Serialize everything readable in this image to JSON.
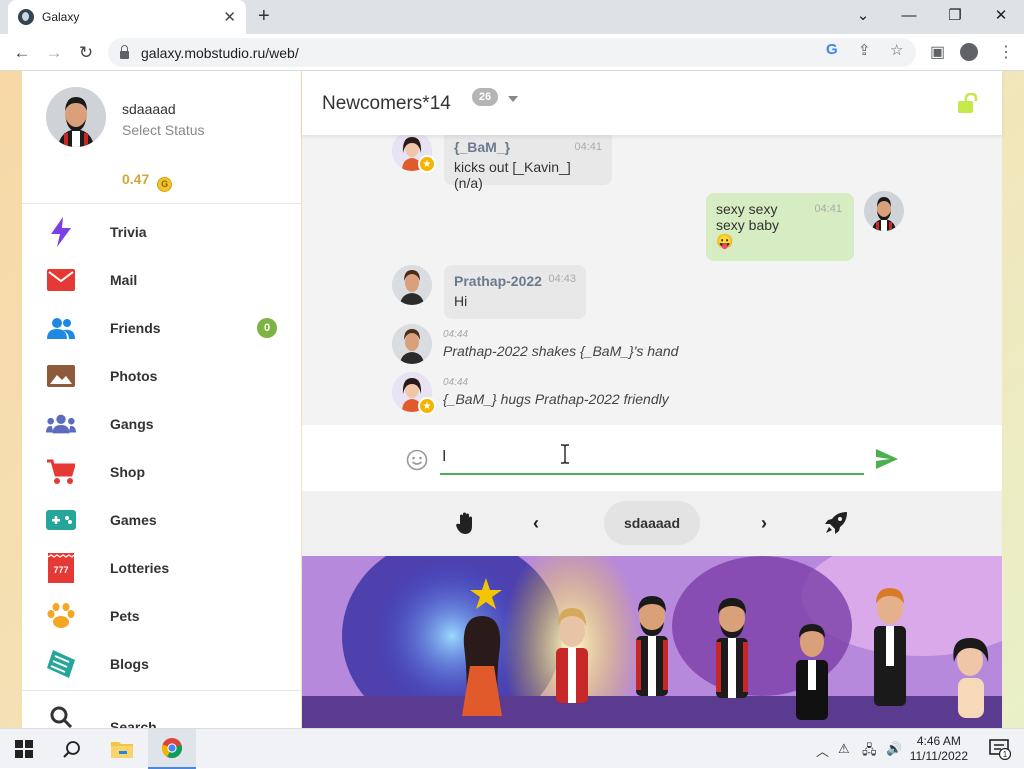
{
  "browser": {
    "tab_title": "Galaxy",
    "url": "galaxy.mobstudio.ru/web/"
  },
  "sidebar": {
    "username": "sdaaaad",
    "status": "Select Status",
    "coins": "0.47",
    "items": [
      {
        "label": "Trivia",
        "icon": "lightning-icon",
        "color": "#7b3fe4"
      },
      {
        "label": "Mail",
        "icon": "mail-icon",
        "color": "#e53935"
      },
      {
        "label": "Friends",
        "icon": "friends-icon",
        "color": "#1e88e5",
        "badge": "0"
      },
      {
        "label": "Photos",
        "icon": "photo-icon",
        "color": "#8d5a3b"
      },
      {
        "label": "Gangs",
        "icon": "group-icon",
        "color": "#5c6bc0"
      },
      {
        "label": "Shop",
        "icon": "cart-icon",
        "color": "#e53935"
      },
      {
        "label": "Games",
        "icon": "gamepad-icon",
        "color": "#26a69a"
      },
      {
        "label": "Lotteries",
        "icon": "ticket-icon",
        "color": "#e53935"
      },
      {
        "label": "Pets",
        "icon": "paw-icon",
        "color": "#f5a623"
      },
      {
        "label": "Blogs",
        "icon": "blog-icon",
        "color": "#26a69a"
      }
    ],
    "search_label": "Search"
  },
  "chat": {
    "room_title": "Newcomers*14",
    "room_count": "26",
    "messages": [
      {
        "name": "{_BaM_}",
        "time": "04:41",
        "text": "kicks out [_Kavin_] (n/a)"
      },
      {
        "name": "",
        "time": "04:41",
        "line1": "sexy sexy",
        "line2": "sexy baby",
        "emoji": "😛"
      },
      {
        "name": "Prathap-2022",
        "time": "04:43",
        "text": "Hi"
      },
      {
        "time": "04:44",
        "text": "Prathap-2022 shakes {_BaM_}'s hand"
      },
      {
        "time": "04:44",
        "text": "{_BaM_} hugs Prathap-2022 friendly"
      }
    ],
    "input_value": "I",
    "nick": "sdaaaad"
  },
  "taskbar": {
    "time": "4:46 AM",
    "date": "11/11/2022",
    "notifications": "1"
  },
  "colors": {
    "accent_green": "#4caf50",
    "badge_green": "#7cb342",
    "coin_gold": "#d4a73a"
  }
}
